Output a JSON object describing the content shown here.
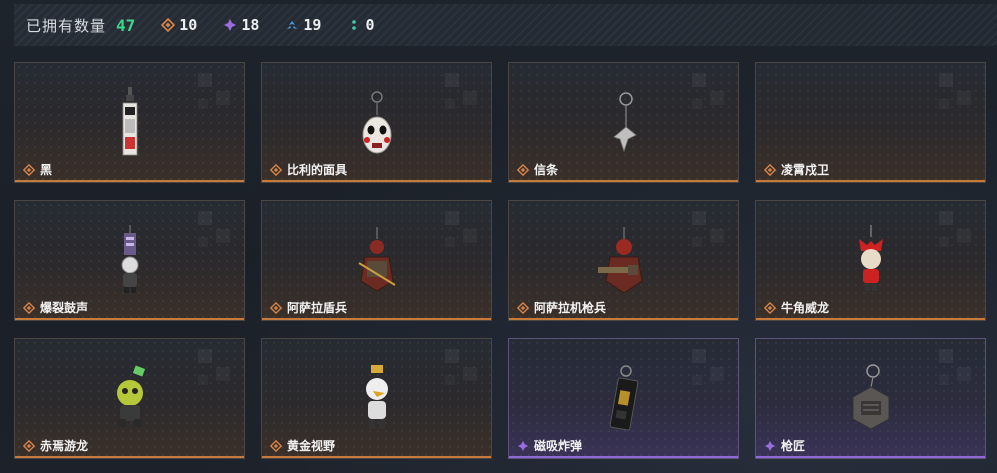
{
  "header": {
    "owned_label": "已拥有数量",
    "owned_count": "47",
    "stats": [
      {
        "icon": "orange-diamond-icon",
        "value": "10",
        "color": "#d9854a"
      },
      {
        "icon": "purple-diamond-icon",
        "value": "18",
        "color": "#9a6de0"
      },
      {
        "icon": "blue-triangle-icon",
        "value": "19",
        "color": "#4a9be0"
      },
      {
        "icon": "teal-dots-icon",
        "value": "0",
        "color": "#3fc9a9"
      }
    ]
  },
  "colors": {
    "owned_count": "#39d98a",
    "orange_rarity": "#c87a3a",
    "purple_rarity": "#8f6ad6"
  },
  "items": [
    {
      "name": "黑",
      "rarity": "orange",
      "icon": "tag-charm-icon"
    },
    {
      "name": "比利的面具",
      "rarity": "orange",
      "icon": "mask-charm-icon"
    },
    {
      "name": "信条",
      "rarity": "orange",
      "icon": "blade-charm-icon"
    },
    {
      "name": "凌霄戍卫",
      "rarity": "orange",
      "icon": "empty-charm-icon"
    },
    {
      "name": "爆裂鼓声",
      "rarity": "orange",
      "icon": "drummer-charm-icon"
    },
    {
      "name": "阿萨拉盾兵",
      "rarity": "orange",
      "icon": "shield-soldier-charm-icon"
    },
    {
      "name": "阿萨拉机枪兵",
      "rarity": "orange",
      "icon": "gunner-charm-icon"
    },
    {
      "name": "牛角威龙",
      "rarity": "orange",
      "icon": "horned-dragon-charm-icon"
    },
    {
      "name": "赤焉游龙",
      "rarity": "orange",
      "icon": "green-dragon-charm-icon"
    },
    {
      "name": "黄金视野",
      "rarity": "orange",
      "icon": "golden-vision-charm-icon"
    },
    {
      "name": "磁吸炸弹",
      "rarity": "purple",
      "icon": "bomb-charm-icon"
    },
    {
      "name": "枪匠",
      "rarity": "purple",
      "icon": "gunsmith-box-charm-icon"
    }
  ]
}
